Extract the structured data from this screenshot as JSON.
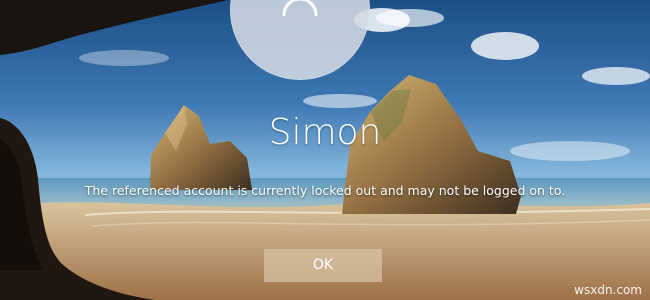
{
  "login": {
    "user_name": "Simon",
    "message": "The referenced account is currently locked out and may not be logged on to.",
    "ok_label": "OK",
    "avatar_icon": "busy-spinner-icon"
  },
  "branding": {
    "watermark": "wsxdn.com"
  },
  "colors": {
    "text": "#ffffff",
    "avatar_background": "#d3dae2",
    "button_background": "#d7c2a4"
  }
}
